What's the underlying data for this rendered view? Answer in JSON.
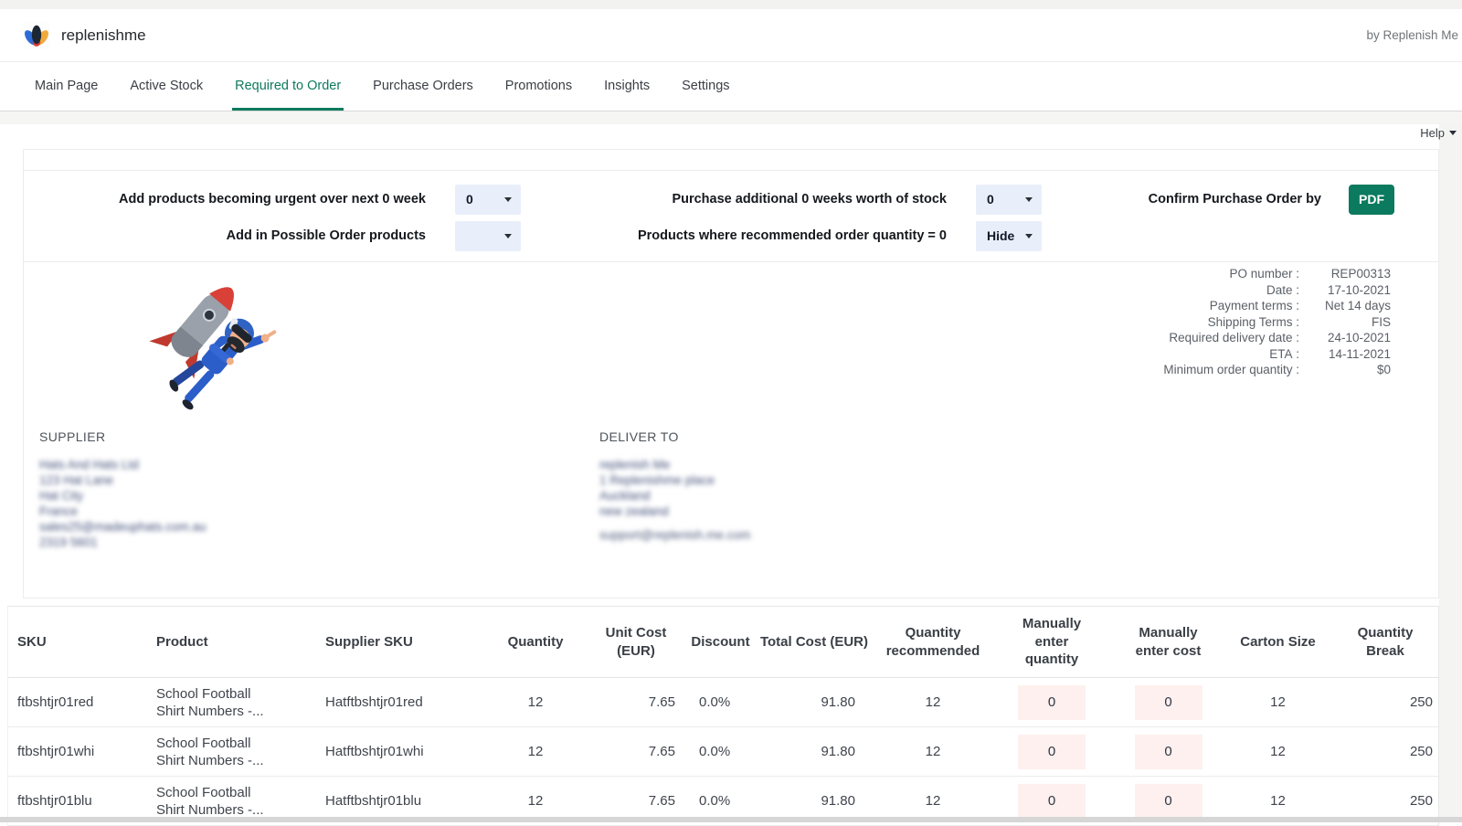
{
  "brand": {
    "name": "replenishme",
    "byline": "by Replenish Me"
  },
  "nav": {
    "tabs": [
      "Main Page",
      "Active Stock",
      "Required to Order",
      "Purchase Orders",
      "Promotions",
      "Insights",
      "Settings"
    ],
    "active_index": 2
  },
  "help": {
    "label": "Help"
  },
  "controls": {
    "row1": {
      "left_label": "Add products becoming urgent over next 0 week",
      "left_value": "0",
      "mid_label": "Purchase additional 0 weeks worth of stock",
      "mid_value": "0",
      "right_label": "Confirm Purchase Order by",
      "pdf_label": "PDF"
    },
    "row2": {
      "left_label": "Add in Possible Order products",
      "left_value": "",
      "mid_label": "Products where recommended order quantity = 0",
      "mid_value": "Hide"
    }
  },
  "po_details": {
    "rows": [
      {
        "label": "PO number",
        "value": "REP00313"
      },
      {
        "label": "Date",
        "value": "17-10-2021"
      },
      {
        "label": "Payment terms",
        "value": "Net 14 days"
      },
      {
        "label": "Shipping Terms",
        "value": "FIS"
      },
      {
        "label": "Required delivery date",
        "value": "24-10-2021"
      },
      {
        "label": "ETA",
        "value": "14-11-2021"
      },
      {
        "label": "Minimum order quantity",
        "value": "$0"
      }
    ]
  },
  "supplier": {
    "title": "SUPPLIER",
    "redacted_lines": [
      "Hats And Hats Ltd",
      "123 Hat Lane",
      "Hat City",
      "France",
      "sales25@madeuphats.com.au",
      "2319 5601"
    ]
  },
  "deliver_to": {
    "title": "DELIVER TO",
    "redacted_lines": [
      "replenish Me",
      "1 Replenishme place",
      "Auckland",
      "new zealand"
    ],
    "redacted_email": "support@replenish.me.com"
  },
  "order_table": {
    "columns": [
      "SKU",
      "Product",
      "Supplier SKU",
      "Quantity",
      "Unit Cost (EUR)",
      "Discount",
      "Total Cost (EUR)",
      "Quantity recommended",
      "Manually enter quantity",
      "Manually enter cost",
      "Carton Size",
      "Quantity Break"
    ],
    "rows": [
      {
        "sku": "ftbshtjr01red",
        "product_lines": [
          "School Football",
          "Shirt Numbers -..."
        ],
        "supplier_sku": "Hatftbshtjr01red",
        "quantity": "12",
        "unit_cost": "7.65",
        "discount": "0.0%",
        "total_cost": "91.80",
        "quantity_recommended": "12",
        "manual_quantity": "0",
        "manual_cost": "0",
        "carton_size": "12",
        "quantity_break": "250"
      },
      {
        "sku": "ftbshtjr01whi",
        "product_lines": [
          "School Football",
          "Shirt Numbers -..."
        ],
        "supplier_sku": "Hatftbshtjr01whi",
        "quantity": "12",
        "unit_cost": "7.65",
        "discount": "0.0%",
        "total_cost": "91.80",
        "quantity_recommended": "12",
        "manual_quantity": "0",
        "manual_cost": "0",
        "carton_size": "12",
        "quantity_break": "250"
      },
      {
        "sku": "ftbshtjr01blu",
        "product_lines": [
          "School Football",
          "Shirt Numbers -..."
        ],
        "supplier_sku": "Hatftbshtjr01blu",
        "quantity": "12",
        "unit_cost": "7.65",
        "discount": "0.0%",
        "total_cost": "91.80",
        "quantity_recommended": "12",
        "manual_quantity": "0",
        "manual_cost": "0",
        "carton_size": "12",
        "quantity_break": "250"
      }
    ]
  },
  "colors": {
    "accent_green": "#0e7a5e",
    "pdf_green": "#0c7a5e",
    "dropdown_bg": "#e9effa",
    "input_pink": "#fdf0ee"
  }
}
